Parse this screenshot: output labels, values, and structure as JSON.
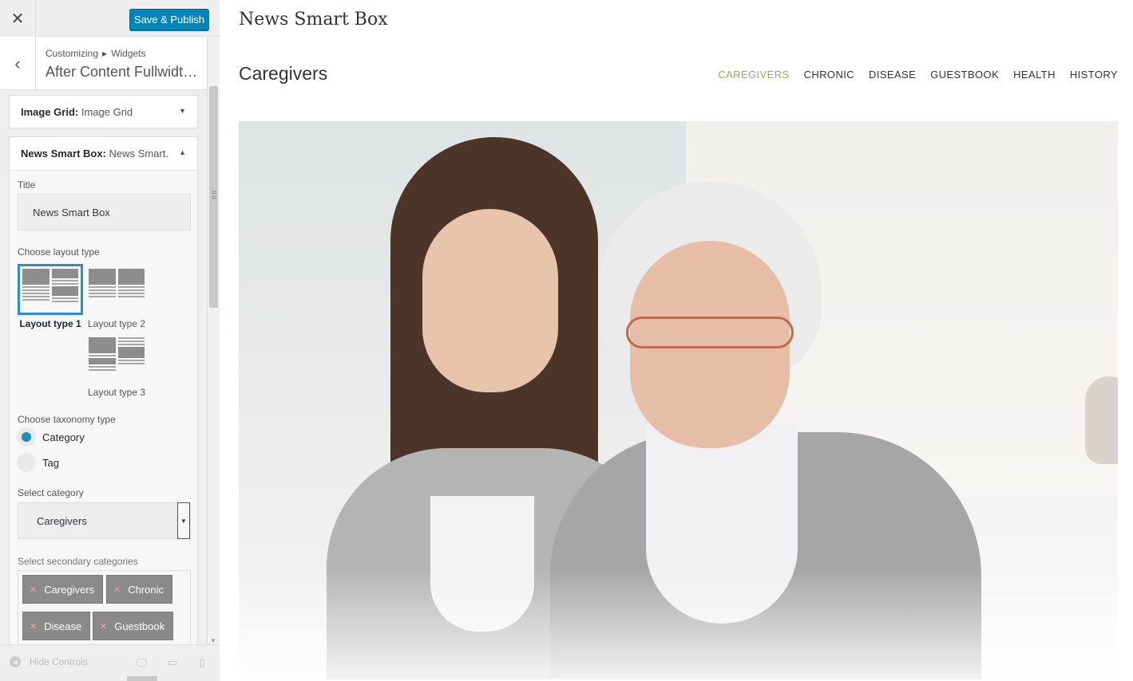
{
  "header": {
    "publish_label": "Save & Publish"
  },
  "section": {
    "crumb_root": "Customizing",
    "crumb_leaf": "Widgets",
    "title": "After Content Fullwidth..."
  },
  "widgets": [
    {
      "type": "Image Grid:",
      "name": " Image Grid",
      "expanded": false
    },
    {
      "type": "News Smart Box:",
      "name": " News Smart...",
      "expanded": true
    }
  ],
  "form": {
    "title_label": "Title",
    "title_value": "News Smart Box",
    "layout_label": "Choose layout type",
    "layouts": [
      {
        "label": "Layout type 1",
        "selected": true
      },
      {
        "label": "Layout type 2",
        "selected": false
      },
      {
        "label": "Layout type 3",
        "selected": false
      }
    ],
    "taxonomy_label": "Choose taxonomy type",
    "taxonomy_options": [
      {
        "label": "Category",
        "checked": true
      },
      {
        "label": "Tag",
        "checked": false
      }
    ],
    "category_label": "Select category",
    "category_value": "Caregivers",
    "secondary_label": "Select secondary categories",
    "secondary_tags": [
      "Caregivers",
      "Chronic",
      "Disease",
      "Guestbook"
    ]
  },
  "footer": {
    "hide_label": "Hide Controls"
  },
  "preview": {
    "site_title": "News Smart Box",
    "category_title": "Caregivers",
    "nav": [
      "CAREGIVERS",
      "CHRONIC",
      "DISEASE",
      "GUESTBOOK",
      "HEALTH",
      "HISTORY"
    ],
    "active_nav": "CAREGIVERS"
  },
  "colors": {
    "accent": "#0085ba",
    "nav_active": "#8db355",
    "radio_on": "#1e8cbe",
    "layout_selected": "#2e8bd0"
  },
  "icons": [
    "close-icon",
    "back-arrow-icon",
    "caret-down-icon",
    "caret-up-icon",
    "remove-tag-icon",
    "desktop-icon",
    "tablet-icon",
    "mobile-icon"
  ]
}
